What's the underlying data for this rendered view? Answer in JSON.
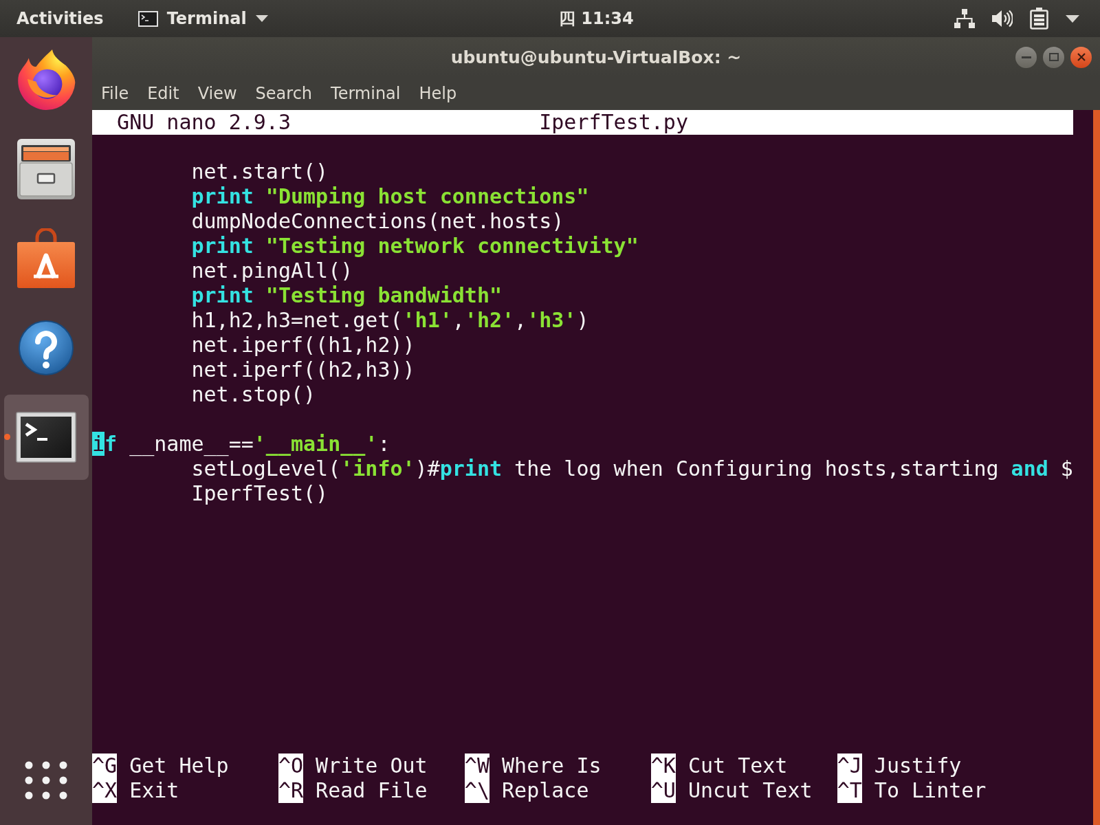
{
  "top_bar": {
    "activities": "Activities",
    "app_menu": {
      "label": "Terminal"
    },
    "clock": "四 11:34"
  },
  "dock": {
    "items": [
      {
        "kind": "browser",
        "running": false,
        "selected": false
      },
      {
        "kind": "files",
        "running": false,
        "selected": false
      },
      {
        "kind": "software",
        "running": false,
        "selected": false
      },
      {
        "kind": "help",
        "running": false,
        "selected": false
      },
      {
        "kind": "terminal",
        "running": true,
        "selected": true
      }
    ]
  },
  "window": {
    "title": "ubuntu@ubuntu-VirtualBox: ~",
    "menu": [
      "File",
      "Edit",
      "View",
      "Search",
      "Terminal",
      "Help"
    ]
  },
  "editor": {
    "title_bar": {
      "version": "GNU nano 2.9.3",
      "filename": "IperfTest.py"
    },
    "blocks": [
      {
        "lines": [
          {
            "indented": true,
            "segments": [
              {
                "kind": "plain",
                "text": "net.start()"
              }
            ]
          },
          {
            "indented": true,
            "segments": [
              {
                "kind": "keyword",
                "text": "print"
              },
              {
                "kind": "string",
                "text": " \"Dumping host connections\""
              }
            ]
          },
          {
            "indented": true,
            "segments": [
              {
                "kind": "plain",
                "text": "dumpNodeConnections(net.hosts)"
              }
            ]
          },
          {
            "indented": true,
            "segments": [
              {
                "kind": "keyword",
                "text": "print"
              },
              {
                "kind": "string",
                "text": " \"Testing network connectivity\""
              }
            ]
          },
          {
            "indented": true,
            "segments": [
              {
                "kind": "plain",
                "text": "net.pingAll()"
              }
            ]
          },
          {
            "indented": true,
            "segments": [
              {
                "kind": "keyword",
                "text": "print"
              },
              {
                "kind": "string",
                "text": " \"Testing bandwidth\""
              }
            ]
          },
          {
            "indented": true,
            "segments": [
              {
                "kind": "plain",
                "text": "h1,h2,h3=net.get("
              },
              {
                "kind": "string",
                "text": "'h1'"
              },
              {
                "kind": "plain",
                "text": ","
              },
              {
                "kind": "string",
                "text": "'h2'"
              },
              {
                "kind": "plain",
                "text": ","
              },
              {
                "kind": "string",
                "text": "'h3'"
              },
              {
                "kind": "plain",
                "text": ")"
              }
            ]
          },
          {
            "indented": true,
            "segments": [
              {
                "kind": "plain",
                "text": "net.iperf((h1,h2))"
              }
            ]
          },
          {
            "indented": true,
            "segments": [
              {
                "kind": "plain",
                "text": "net.iperf((h2,h3))"
              }
            ]
          },
          {
            "indented": true,
            "segments": [
              {
                "kind": "plain",
                "text": "net.stop()"
              }
            ]
          }
        ]
      },
      {
        "lines": [
          {
            "indented": false,
            "segments": [
              {
                "kind": "cursor",
                "text": "i"
              },
              {
                "kind": "keyword",
                "text": "f"
              },
              {
                "kind": "plain",
                "text": " __name__=="
              },
              {
                "kind": "string",
                "text": "'__main__'"
              },
              {
                "kind": "plain",
                "text": ":"
              }
            ]
          },
          {
            "indented": true,
            "segments": [
              {
                "kind": "plain",
                "text": "setLogLevel("
              },
              {
                "kind": "string",
                "text": "'info'"
              },
              {
                "kind": "plain",
                "text": ")#"
              },
              {
                "kind": "keyword",
                "text": "print"
              },
              {
                "kind": "plain",
                "text": " the log when Configuring hosts,starting "
              },
              {
                "kind": "keyword",
                "text": "and"
              },
              {
                "kind": "plain",
                "text": " $"
              }
            ]
          },
          {
            "indented": true,
            "segments": [
              {
                "kind": "plain",
                "text": "IperfTest()"
              }
            ]
          }
        ]
      }
    ],
    "shortcuts": [
      {
        "key": "^G",
        "label": "Get Help"
      },
      {
        "key": "^O",
        "label": "Write Out"
      },
      {
        "key": "^W",
        "label": "Where Is"
      },
      {
        "key": "^K",
        "label": "Cut Text"
      },
      {
        "key": "^J",
        "label": "Justify"
      },
      {
        "key": "^X",
        "label": "Exit"
      },
      {
        "key": "^R",
        "label": "Read File"
      },
      {
        "key": "^\\",
        "label": "Replace"
      },
      {
        "key": "^U",
        "label": "Uncut Text"
      },
      {
        "key": "^T",
        "label": "To Linter"
      }
    ]
  }
}
